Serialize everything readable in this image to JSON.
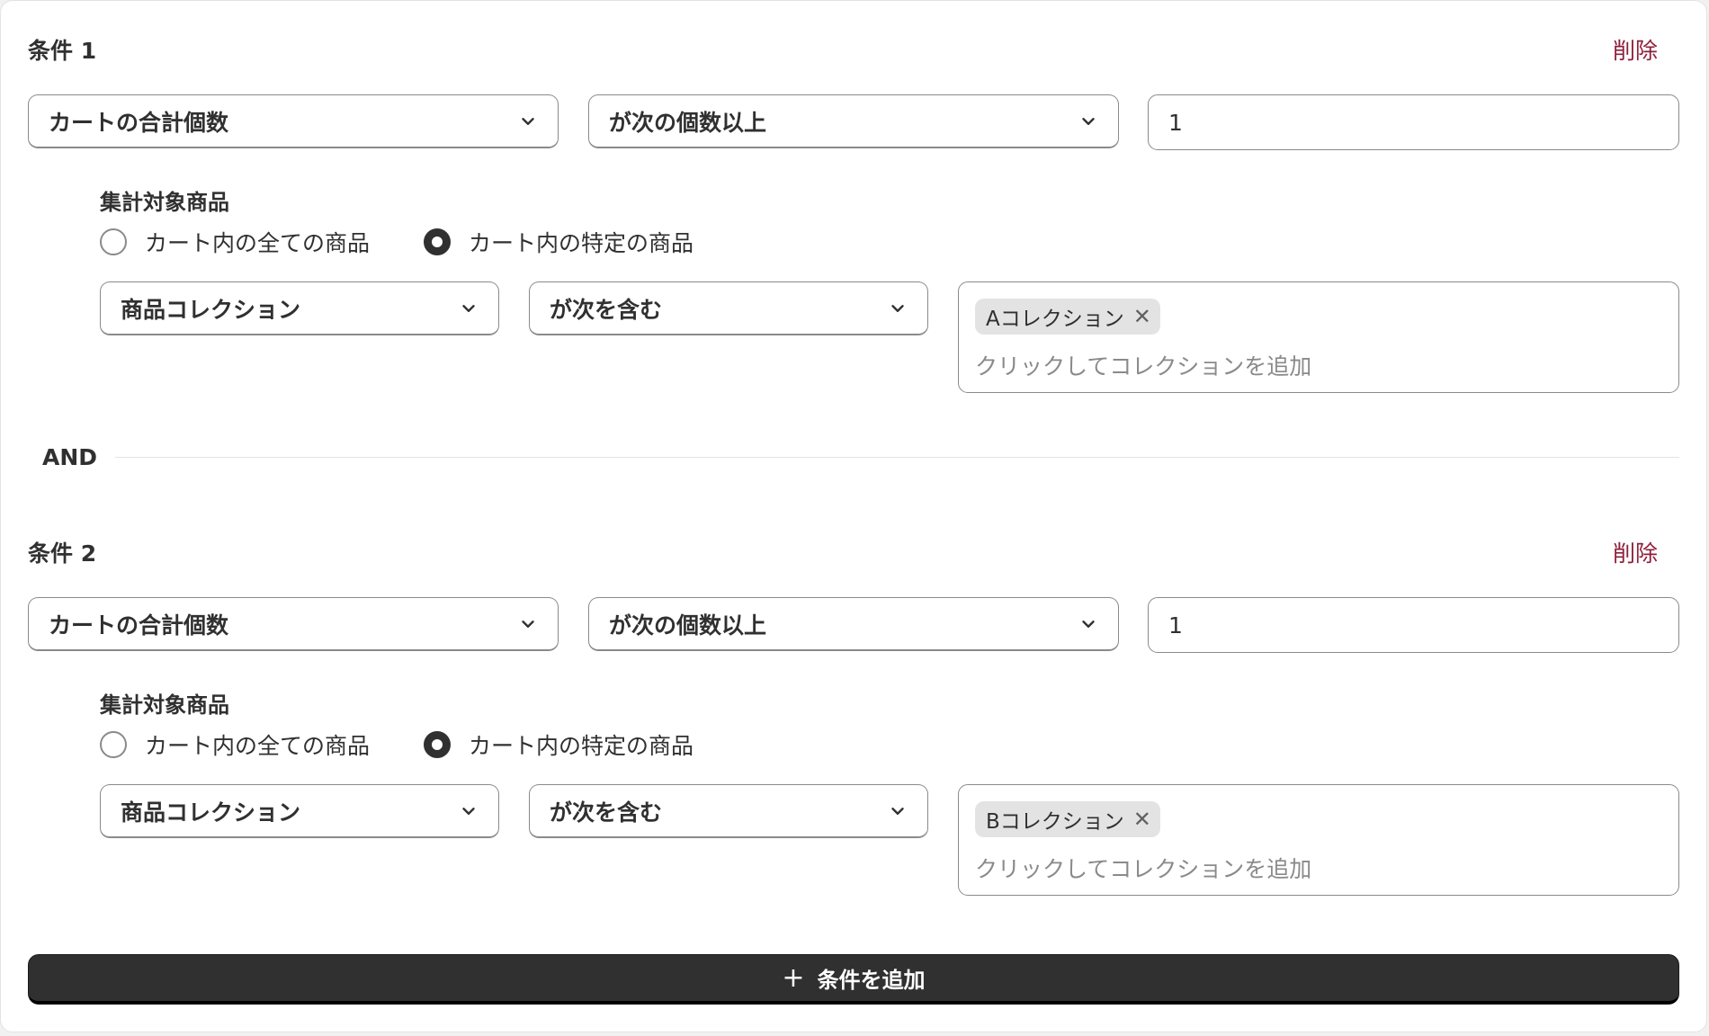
{
  "conditions": [
    {
      "title": "条件 1",
      "delete_label": "削除",
      "metric_select": "カートの合計個数",
      "operator_select": "が次の個数以上",
      "quantity_value": "1",
      "target_label": "集計対象商品",
      "radio_all_label": "カート内の全ての商品",
      "radio_specific_label": "カート内の特定の商品",
      "radio_selected": "specific",
      "filter_type_select": "商品コレクション",
      "filter_operator_select": "が次を含む",
      "tags": [
        "Aコレクション"
      ],
      "tag_placeholder": "クリックしてコレクションを追加"
    },
    {
      "title": "条件 2",
      "delete_label": "削除",
      "metric_select": "カートの合計個数",
      "operator_select": "が次の個数以上",
      "quantity_value": "1",
      "target_label": "集計対象商品",
      "radio_all_label": "カート内の全ての商品",
      "radio_specific_label": "カート内の特定の商品",
      "radio_selected": "specific",
      "filter_type_select": "商品コレクション",
      "filter_operator_select": "が次を含む",
      "tags": [
        "Bコレクション"
      ],
      "tag_placeholder": "クリックしてコレクションを追加"
    }
  ],
  "and_label": "AND",
  "add_condition_label": "条件を追加",
  "icons": {
    "select_arrow": "chevron-down-icon",
    "tag_remove": "close-icon",
    "add": "plus-icon"
  },
  "colors": {
    "delete_link": "#8e1f3b",
    "primary_button": "#303030",
    "tag_background": "#e3e3e3"
  }
}
